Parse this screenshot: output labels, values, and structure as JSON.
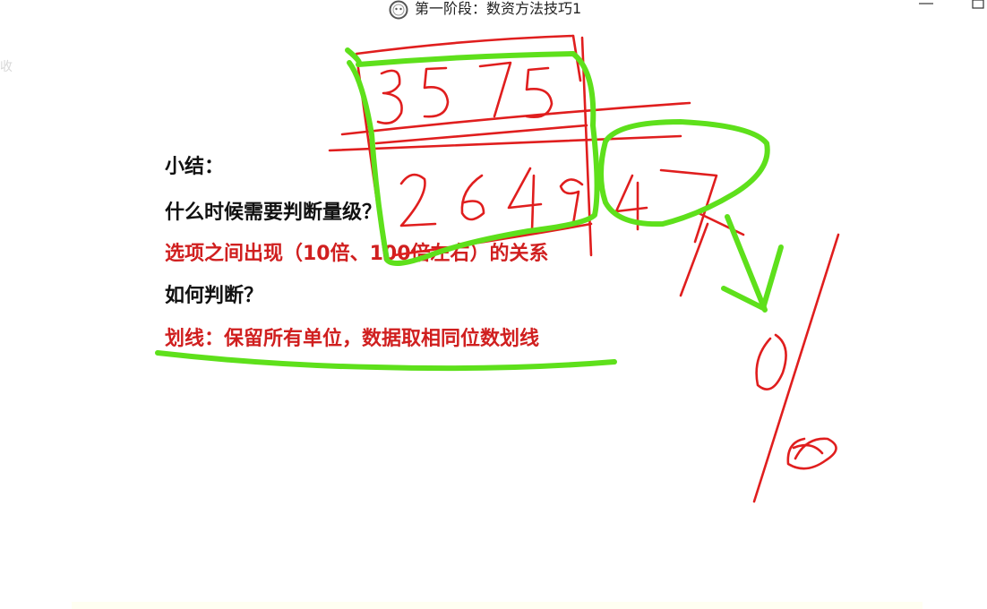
{
  "window": {
    "title": "第一阶段：数资方法技巧1",
    "icon": "video-player-app-icon"
  },
  "edge_glyph": "收",
  "summary": {
    "heading": "小结：",
    "question1": "什么时候需要判断量级？",
    "answer1": "选项之间出现（10倍、100倍左右）的关系",
    "question2": "如何判断？",
    "answer2": "划线：保留所有单位，数据取相同位数划线"
  },
  "handwriting": {
    "number_top": "3575",
    "number_bottom": "2649",
    "boxed_digits": "47",
    "fraction_numerator": "0",
    "fraction_denominator": "0"
  },
  "colors": {
    "background": "#ffffff",
    "text": "#111111",
    "emphasis_red": "#d01f1f",
    "ink_red": "#e01e1e",
    "ink_green": "#5ee01b"
  }
}
